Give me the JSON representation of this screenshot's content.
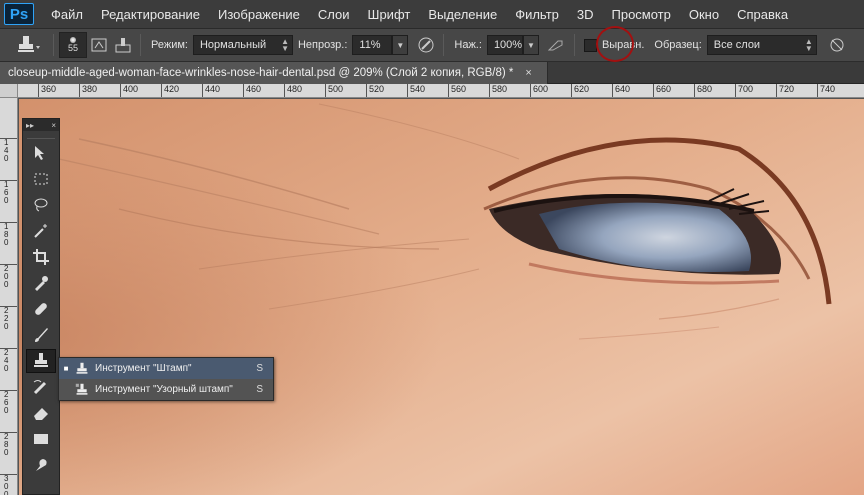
{
  "app": {
    "logo": "Ps"
  },
  "menu": [
    "Файл",
    "Редактирование",
    "Изображение",
    "Слои",
    "Шрифт",
    "Выделение",
    "Фильтр",
    "3D",
    "Просмотр",
    "Окно",
    "Справка"
  ],
  "options": {
    "brush_size": "55",
    "mode_label": "Режим:",
    "mode_value": "Нормальный",
    "opacity_label": "Непрозр.:",
    "opacity_value": "11%",
    "flow_label": "Наж.:",
    "flow_value": "100%",
    "aligned_label": "Выравн.",
    "aligned_checked": false,
    "sample_label": "Образец:",
    "sample_value": "Все слои"
  },
  "document": {
    "tab_title": "closeup-middle-aged-woman-face-wrinkles-nose-hair-dental.psd @ 209% (Слой 2 копия, RGB/8) *",
    "close": "×"
  },
  "ruler": {
    "h_ticks": [
      "360",
      "380",
      "400",
      "420",
      "440",
      "460",
      "480",
      "500",
      "520",
      "540",
      "560",
      "580",
      "600",
      "620",
      "640",
      "660",
      "680",
      "700",
      "720",
      "740"
    ],
    "v_ticks": [
      "1\n4\n0",
      "1\n6\n0",
      "1\n8\n0",
      "2\n0\n0",
      "2\n2\n0",
      "2\n4\n0",
      "2\n6\n0",
      "2\n8\n0",
      "3\n0\n0"
    ]
  },
  "tools": [
    "move-icon",
    "marquee-icon",
    "lasso-icon",
    "magic-wand-icon",
    "crop-icon",
    "eyedropper-icon",
    "healing-brush-icon",
    "brush-icon",
    "clone-stamp-icon",
    "history-brush-icon",
    "eraser-icon",
    "gradient-icon",
    "smudge-icon"
  ],
  "flyout": {
    "items": [
      {
        "label": "Инструмент \"Штамп\"",
        "key": "S",
        "selected": true
      },
      {
        "label": "Инструмент \"Узорный штамп\"",
        "key": "S",
        "selected": false
      }
    ]
  },
  "colors": {
    "menubar": "#3c3c3c",
    "options_bar": "#474747",
    "annotation": "#a31010",
    "selection": "#4a5a70"
  }
}
